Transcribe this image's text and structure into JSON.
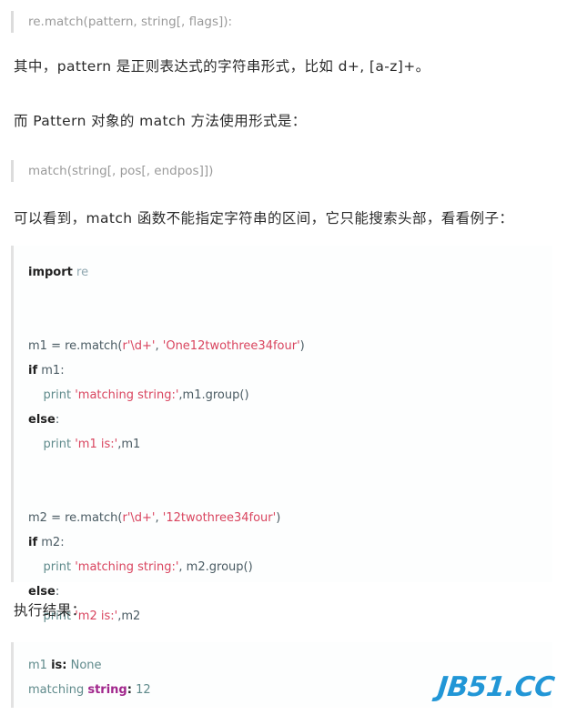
{
  "document": {
    "type": "python-tutorial-article",
    "language": "zh-CN",
    "watermark": "JB51.CC",
    "watermark_color": "#2196d6"
  },
  "signatures": {
    "re_match": "re.match(pattern, string[, flags]):",
    "pattern_match": "match(string[, pos[, endpos]])"
  },
  "paragraphs": {
    "p1": "其中，pattern 是正则表达式的字符串形式，比如 d+, [a-z]+。",
    "p2": "而 Pattern 对象的 match 方法使用形式是：",
    "p3": "可以看到，match 函数不能指定字符串的区间，它只能搜索头部，看看例子：",
    "p4": "执行结果："
  },
  "code": {
    "lines": [
      {
        "id": "l1",
        "tokens": [
          {
            "t": "import",
            "c": "kw"
          },
          {
            "t": " ",
            "c": "op"
          },
          {
            "t": "re",
            "c": "name"
          }
        ]
      },
      {
        "id": "l2",
        "tokens": []
      },
      {
        "id": "l3",
        "tokens": []
      },
      {
        "id": "l4",
        "tokens": [
          {
            "t": "m1 = re.match(",
            "c": "var"
          },
          {
            "t": "r'\\d+'",
            "c": "str"
          },
          {
            "t": ", ",
            "c": "var"
          },
          {
            "t": "'One12twothree34four'",
            "c": "str"
          },
          {
            "t": ")",
            "c": "var"
          }
        ]
      },
      {
        "id": "l5",
        "tokens": [
          {
            "t": "if",
            "c": "kw"
          },
          {
            "t": " m1:",
            "c": "var"
          }
        ]
      },
      {
        "id": "l6",
        "tokens": [
          {
            "t": "    ",
            "c": "op"
          },
          {
            "t": "print",
            "c": "pr"
          },
          {
            "t": " ",
            "c": "op"
          },
          {
            "t": "'matching string:'",
            "c": "str"
          },
          {
            "t": ",m1.group()",
            "c": "var"
          }
        ]
      },
      {
        "id": "l7",
        "tokens": [
          {
            "t": "else",
            "c": "kw"
          },
          {
            "t": ":",
            "c": "var"
          }
        ]
      },
      {
        "id": "l8",
        "tokens": [
          {
            "t": "    ",
            "c": "op"
          },
          {
            "t": "print",
            "c": "pr"
          },
          {
            "t": " ",
            "c": "op"
          },
          {
            "t": "'m1 is:'",
            "c": "str"
          },
          {
            "t": ",m1",
            "c": "var"
          }
        ]
      },
      {
        "id": "l9",
        "tokens": []
      },
      {
        "id": "l10",
        "tokens": []
      },
      {
        "id": "l11",
        "tokens": [
          {
            "t": "m2 = re.match(",
            "c": "var"
          },
          {
            "t": "r'\\d+'",
            "c": "str"
          },
          {
            "t": ", ",
            "c": "var"
          },
          {
            "t": "'12twothree34four'",
            "c": "str"
          },
          {
            "t": ")",
            "c": "var"
          }
        ]
      },
      {
        "id": "l12",
        "tokens": [
          {
            "t": "if",
            "c": "kw"
          },
          {
            "t": " m2:",
            "c": "var"
          }
        ]
      },
      {
        "id": "l13",
        "tokens": [
          {
            "t": "    ",
            "c": "op"
          },
          {
            "t": "print",
            "c": "pr"
          },
          {
            "t": " ",
            "c": "op"
          },
          {
            "t": "'matching string:'",
            "c": "str"
          },
          {
            "t": ", m2.group()",
            "c": "var"
          }
        ]
      },
      {
        "id": "l14",
        "tokens": [
          {
            "t": "else",
            "c": "kw"
          },
          {
            "t": ":",
            "c": "var"
          }
        ]
      },
      {
        "id": "l15",
        "tokens": [
          {
            "t": "    ",
            "c": "op"
          },
          {
            "t": "print",
            "c": "pr"
          },
          {
            "t": " ",
            "c": "op"
          },
          {
            "t": "'m2 is:'",
            "c": "str"
          },
          {
            "t": ",m2",
            "c": "var"
          }
        ]
      }
    ],
    "plain_text": "import re\n\n\nm1 = re.match(r'\\d+', 'One12twothree34four')\nif m1:\n    print 'matching string:',m1.group()\nelse:\n    print 'm1 is:',m1\n\n\nm2 = re.match(r'\\d+', '12twothree34four')\nif m2:\n    print 'matching string:', m2.group()\nelse:\n    print 'm2 is:',m2"
  },
  "output": {
    "lines": [
      {
        "id": "o1",
        "tokens": [
          {
            "t": "m1 ",
            "c": "out"
          },
          {
            "t": "is",
            "c": "outkw"
          },
          {
            "t": ":",
            "c": "outkw"
          },
          {
            "t": " None",
            "c": "out"
          }
        ]
      },
      {
        "id": "o2",
        "tokens": [
          {
            "t": "matching ",
            "c": "out"
          },
          {
            "t": "string",
            "c": "outmag"
          },
          {
            "t": ":",
            "c": "outkw"
          },
          {
            "t": " 12",
            "c": "out"
          }
        ]
      }
    ],
    "plain_text": "m1 is: None\nmatching string: 12"
  }
}
